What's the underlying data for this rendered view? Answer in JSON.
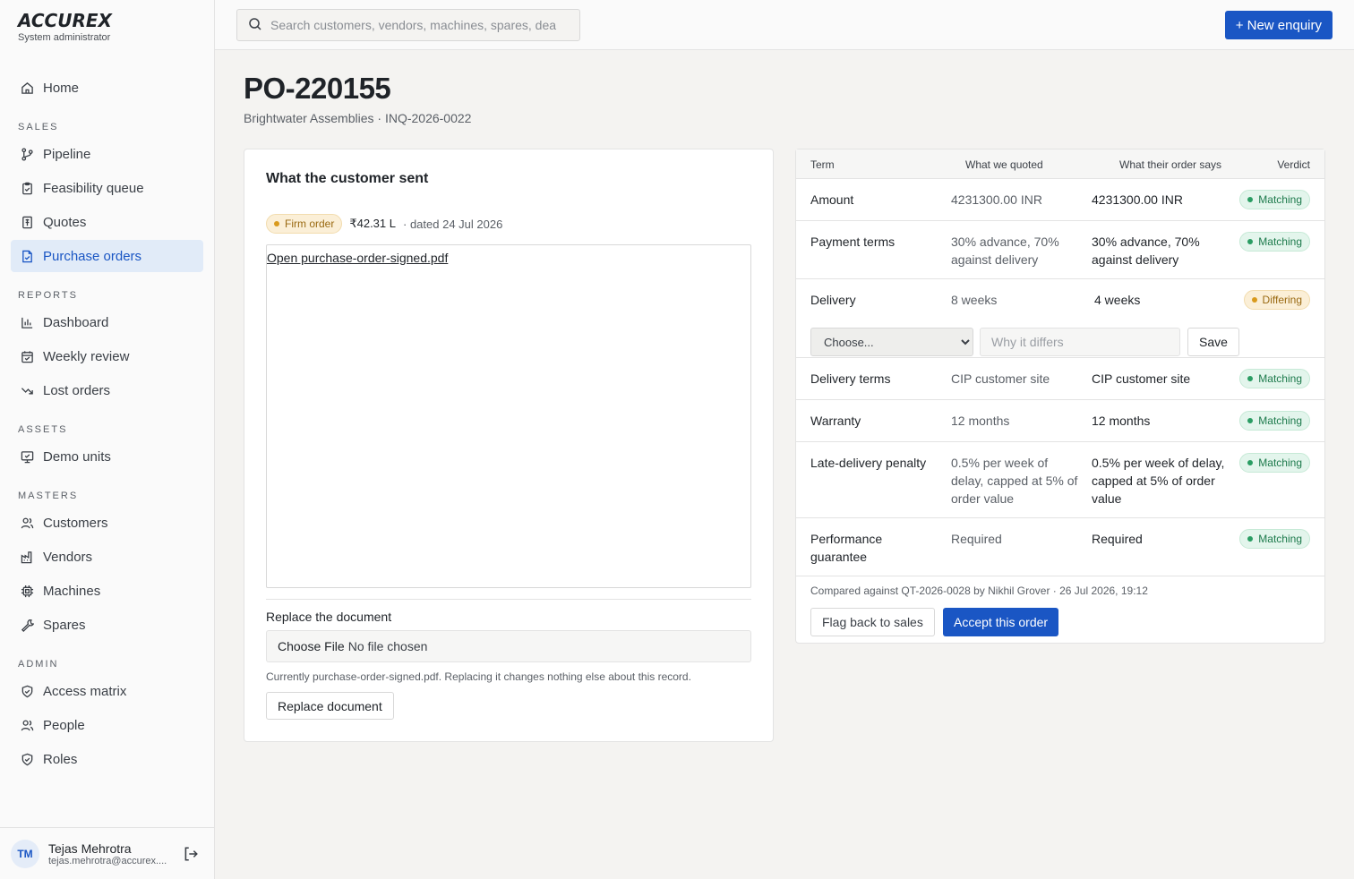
{
  "brand": {
    "logo": "ACCUREX",
    "role": "System administrator"
  },
  "search": {
    "placeholder": "Search customers, vendors, machines, spares, dea"
  },
  "header": {
    "new_enquiry": "+ New enquiry"
  },
  "sidebar": {
    "home": "Home",
    "sections": {
      "sales": "SALES",
      "reports": "REPORTS",
      "assets": "ASSETS",
      "masters": "MASTERS",
      "admin": "ADMIN"
    },
    "items": {
      "pipeline": "Pipeline",
      "feasibility": "Feasibility queue",
      "quotes": "Quotes",
      "purchase_orders": "Purchase orders",
      "dashboard": "Dashboard",
      "weekly_review": "Weekly review",
      "lost_orders": "Lost orders",
      "demo_units": "Demo units",
      "customers": "Customers",
      "vendors": "Vendors",
      "machines": "Machines",
      "spares": "Spares",
      "access_matrix": "Access matrix",
      "people": "People",
      "roles": "Roles"
    },
    "active": "purchase_orders"
  },
  "user": {
    "initials": "TM",
    "name": "Tejas Mehrotra",
    "email": "tejas.mehrotra@accurex...."
  },
  "page": {
    "title": "PO-220155",
    "subtitle": "Brightwater Assemblies · INQ-2026-0022"
  },
  "customer_doc": {
    "title": "What the customer sent",
    "badge": "Firm order",
    "amount": "₹42.31 L",
    "dated": "· dated 24 Jul 2026",
    "link": "Open purchase-order-signed.pdf",
    "replace_label": "Replace the document",
    "choose_file": "Choose File",
    "no_file": "No file chosen",
    "help": "Currently purchase-order-signed.pdf. Replacing it changes nothing else about this record.",
    "replace_button": "Replace document"
  },
  "comparison": {
    "headers": {
      "term": "Term",
      "quoted": "What we quoted",
      "says": "What their order says",
      "verdict": "Verdict"
    },
    "rows": [
      {
        "term": "Amount",
        "quoted": "4231300.00 INR",
        "says": "4231300.00 INR",
        "verdict": "Matching"
      },
      {
        "term": "Payment terms",
        "quoted": "30% advance, 70% against delivery",
        "says": "30% advance, 70% against delivery",
        "verdict": "Matching"
      },
      {
        "term": "Delivery",
        "quoted": "8 weeks",
        "says": "4 weeks",
        "verdict": "Differing"
      },
      {
        "term": "Delivery terms",
        "quoted": "CIP customer site",
        "says": "CIP customer site",
        "verdict": "Matching"
      },
      {
        "term": "Warranty",
        "quoted": "12 months",
        "says": "12 months",
        "verdict": "Matching"
      },
      {
        "term": "Late-delivery penalty",
        "quoted": "0.5% per week of delay, capped at 5% of order value",
        "says": "0.5% per week of delay, capped at 5% of order value",
        "verdict": "Matching"
      },
      {
        "term": "Performance guarantee",
        "quoted": "Required",
        "says": "Required",
        "verdict": "Matching"
      }
    ],
    "diff_select": "Choose...",
    "diff_placeholder": "Why it differs",
    "save": "Save",
    "compared_note": "Compared against QT-2026-0028 by Nikhil Grover · 26 Jul 2026, 19:12",
    "flag_button": "Flag back to sales",
    "accept_button": "Accept this order"
  },
  "colors": {
    "accent": "#1a56c4",
    "matching": "#2a9d63",
    "differing": "#d99a1d"
  }
}
